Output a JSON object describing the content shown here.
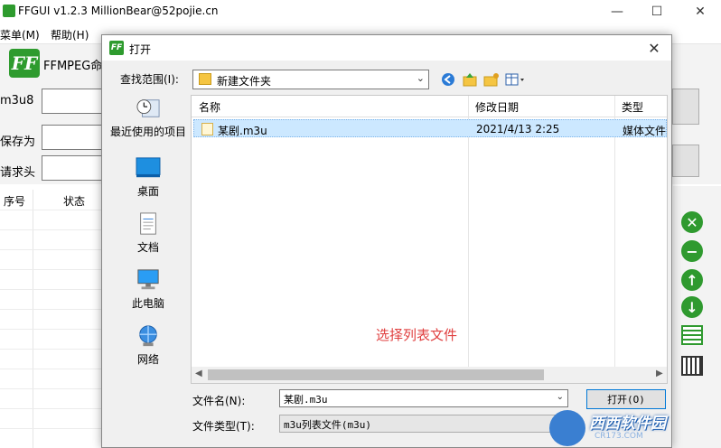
{
  "background_app": {
    "title": "FFGUI v1.2.3    MillionBear@52pojie.cn",
    "window_controls": [
      "—",
      "☐",
      "✕"
    ],
    "menu": [
      "菜单(M)",
      "帮助(H)"
    ],
    "logo_text": "FF",
    "app_name": "FFMPEG命",
    "form_labels": [
      "m3u8",
      "保存为",
      "请求头"
    ],
    "grid_headers": [
      "序号",
      "状态"
    ],
    "accent_color": "#2e9b2e"
  },
  "dialog": {
    "title": "打开",
    "close_label": "✕",
    "lookin_label": "查找范围(I):",
    "lookin_value": "新建文件夹",
    "toolbar_icons": [
      "back-icon",
      "up-folder-icon",
      "new-folder-icon",
      "view-menu-icon"
    ],
    "places": [
      {
        "label": "最近使用的项目",
        "icon": "recent-icon"
      },
      {
        "label": "桌面",
        "icon": "desktop-icon"
      },
      {
        "label": "文档",
        "icon": "documents-icon"
      },
      {
        "label": "此电脑",
        "icon": "computer-icon"
      },
      {
        "label": "网络",
        "icon": "network-icon"
      }
    ],
    "columns": [
      "名称",
      "修改日期",
      "类型"
    ],
    "files": [
      {
        "name": "某剧.m3u",
        "modified": "2021/4/13 2:25",
        "type": "媒体文件("
      }
    ],
    "annotation": "选择列表文件",
    "filename_label": "文件名(N):",
    "filename_value": "某剧.m3u",
    "filetype_label": "文件类型(T):",
    "filetype_value": "m3u列表文件(m3u)",
    "open_button": "打开(O)"
  },
  "watermark": {
    "text": "西西软件园",
    "sub": "CR173.COM"
  }
}
